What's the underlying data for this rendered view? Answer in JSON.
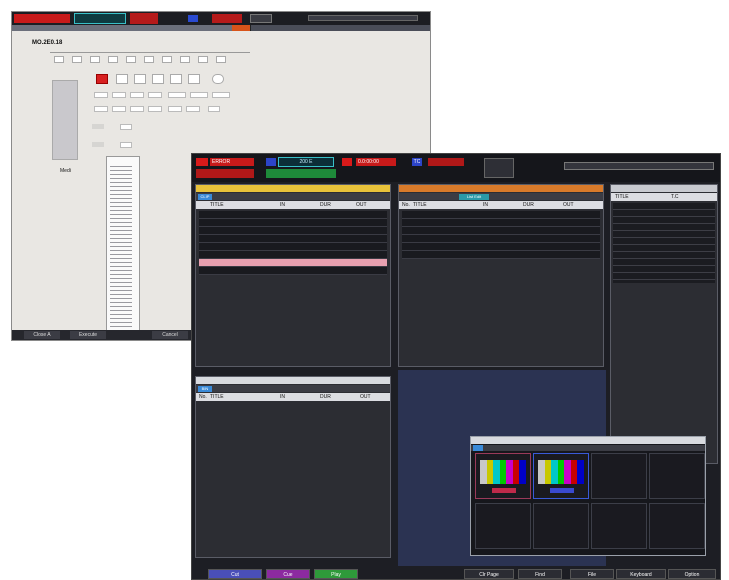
{
  "back_window": {
    "section_label": "MO.2E0.18",
    "status_label": "Medi",
    "bottom_buttons": [
      "Close A",
      "Execute",
      "Cancel"
    ]
  },
  "front_window": {
    "top_status": {
      "left_red_a": "ERROR",
      "center_label": "200 E",
      "right_red_a": "0.0:00:00",
      "right_label": "TC"
    },
    "panel_clip": {
      "tab": "CLIP",
      "header_title": "TITLE",
      "header_in": "IN",
      "header_dur": "DUR",
      "header_out": "OUT"
    },
    "panel_playlist": {
      "tab": "List Edit",
      "header_no": "No.",
      "header_title": "TITLE",
      "header_in": "IN",
      "header_dur": "DUR",
      "header_out": "OUT"
    },
    "panel_bin": {
      "tab": "BIN",
      "header_no": "No.",
      "header_title": "TITLE",
      "header_in": "IN",
      "header_dur": "DUR",
      "header_out": "OUT"
    },
    "panel_info": {
      "header_title": "TITLE",
      "header_tc": "T.C"
    },
    "function_keys": [
      "Cut",
      "Cue",
      "Play",
      "Clr Page",
      "Find",
      "File",
      "Keyboard",
      "Option"
    ],
    "fkey_colors": [
      "#4a4fb8",
      "#8c2aa0",
      "#2e9a3a",
      "#2b2c33",
      "#2b2c33",
      "#2b2c33",
      "#2b2c33",
      "#2b2c33"
    ]
  }
}
